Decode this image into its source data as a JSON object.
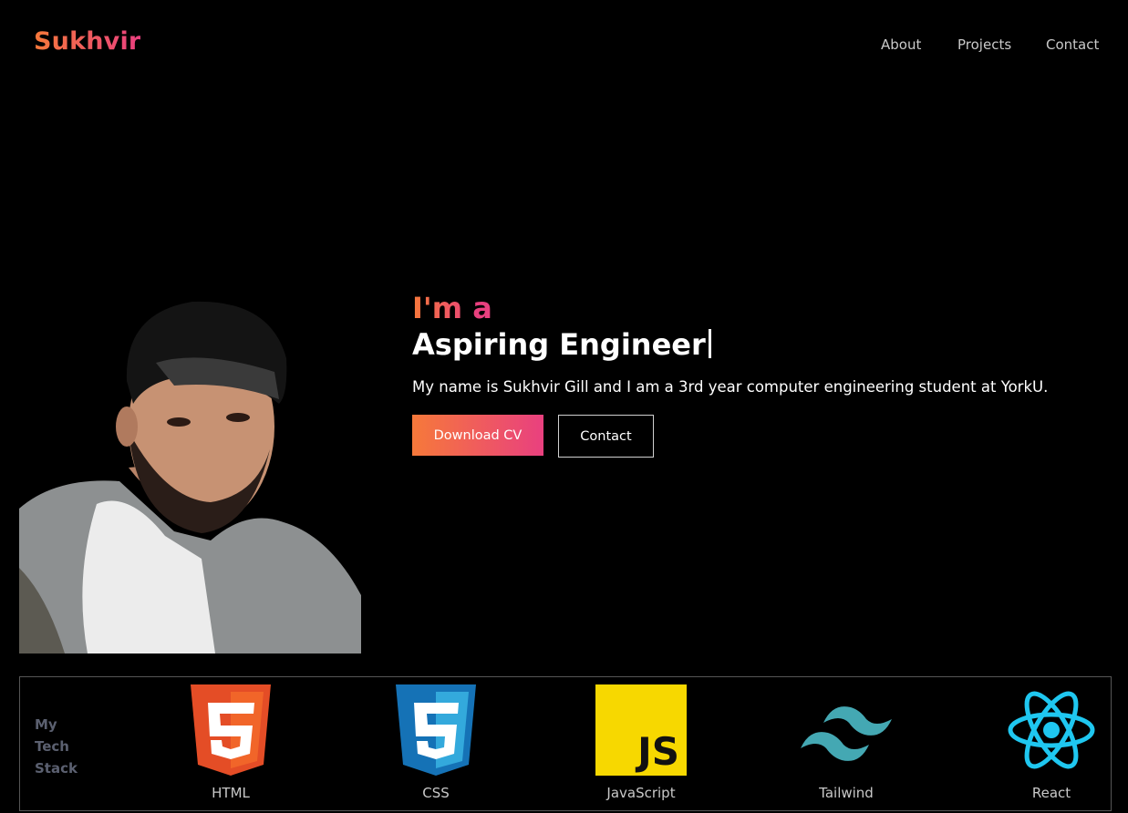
{
  "header": {
    "logo": "Sukhvir",
    "nav": [
      "About",
      "Projects",
      "Contact"
    ]
  },
  "hero": {
    "prefix": "I'm a",
    "role": "Aspiring Engineer",
    "description": "My name is Sukhvir Gill and I am a 3rd year computer engineering student at YorkU.",
    "primary_button": "Download CV",
    "secondary_button": "Contact"
  },
  "stack": {
    "title": "My Tech Stack",
    "items": [
      {
        "label": "HTML",
        "icon": "html5-icon"
      },
      {
        "label": "CSS",
        "icon": "css3-icon"
      },
      {
        "label": "JavaScript",
        "icon": "javascript-icon"
      },
      {
        "label": "Tailwind",
        "icon": "tailwind-icon"
      },
      {
        "label": "React",
        "icon": "react-icon"
      }
    ]
  },
  "colors": {
    "accent_start": "#f6793a",
    "accent_end": "#e9407f",
    "background": "#000000"
  }
}
